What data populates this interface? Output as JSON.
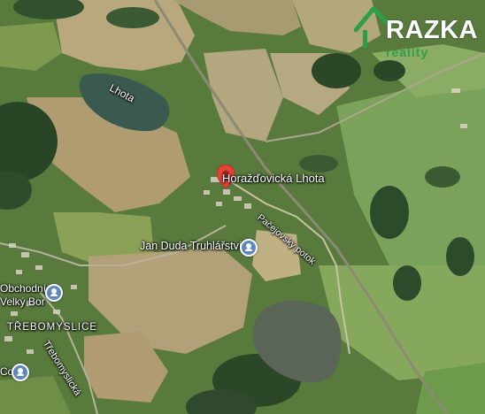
{
  "map": {
    "lake_label": "Lhota",
    "town_label": "Horažďovická Lhota",
    "poi_carpentry": "Jan Duda Truhlářství",
    "poi_shop_line1": "Obchodní",
    "poi_shop_line2": "Velký Bor",
    "district_label": "TŘEBOMYSLICE",
    "road_label": "Třebomyslická",
    "stream_label": "Pačejovský potok",
    "poi_partial": "Co"
  },
  "logo": {
    "word": "RAZKA",
    "subword": "reality",
    "colors": {
      "primary": "#2f9e4a",
      "text": "#ffffff"
    }
  },
  "colors": {
    "pin": "#e5443a",
    "poi": "#5f87b8",
    "label_text": "#ffffff"
  }
}
